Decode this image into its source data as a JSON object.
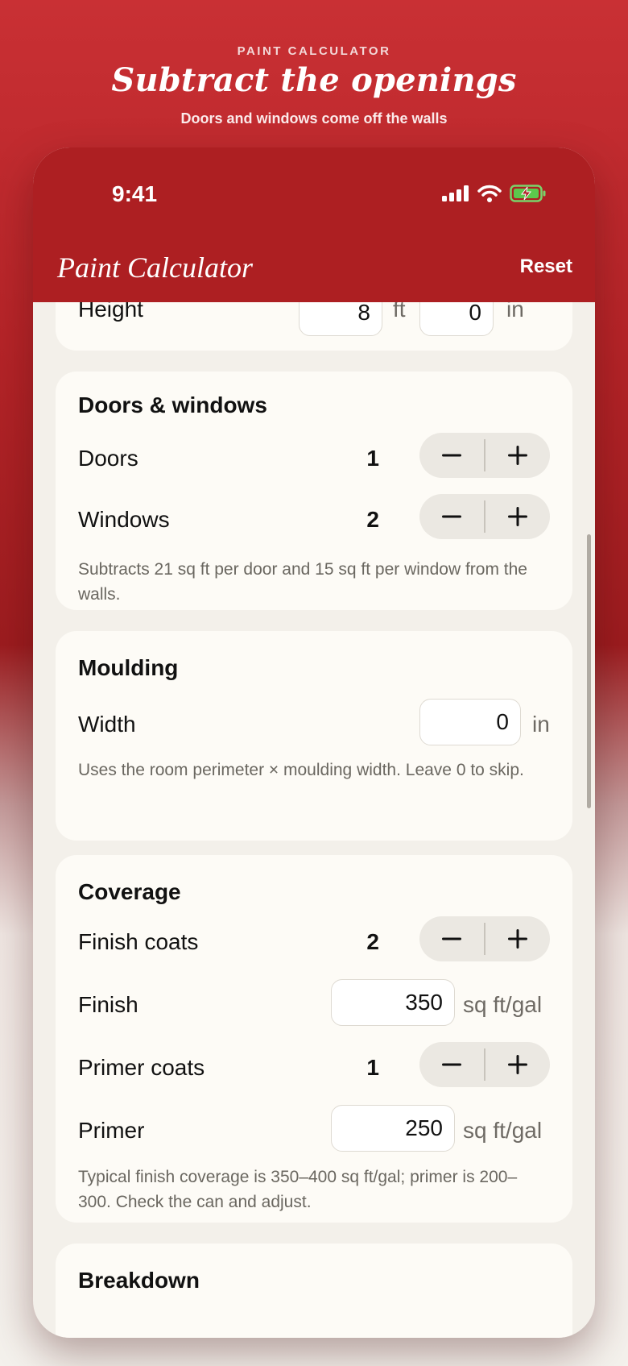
{
  "promo": {
    "eyebrow": "PAINT CALCULATOR",
    "title": "Subtract the openings",
    "subtitle": "Doors and windows come off the walls"
  },
  "status_bar": {
    "time": "9:41"
  },
  "app_bar": {
    "title": "Paint Calculator",
    "reset_label": "Reset"
  },
  "dimensions": {
    "height_label": "Height",
    "height_ft": "8",
    "ft_unit": "ft",
    "height_in": "0",
    "in_unit": "in"
  },
  "openings": {
    "title": "Doors & windows",
    "doors_label": "Doors",
    "doors_count": "1",
    "windows_label": "Windows",
    "windows_count": "2",
    "note": "Subtracts 21 sq ft per door and 15 sq ft per window from the walls."
  },
  "moulding": {
    "title": "Moulding",
    "width_label": "Width",
    "width_value": "0",
    "unit": "in",
    "note": "Uses the room perimeter × moulding width. Leave 0 to skip."
  },
  "coverage": {
    "title": "Coverage",
    "finish_coats_label": "Finish coats",
    "finish_coats_count": "2",
    "finish_label": "Finish",
    "finish_value": "350",
    "primer_coats_label": "Primer coats",
    "primer_coats_count": "1",
    "primer_label": "Primer",
    "primer_value": "250",
    "unit": "sq ft/gal",
    "note": "Typical finish coverage is 350–400 sq ft/gal; primer is 200–300. Check the can and adjust."
  },
  "breakdown": {
    "title": "Breakdown"
  },
  "colors": {
    "accent": "#ad1f22",
    "card": "#fdfbf6",
    "background": "#f3f0ea"
  }
}
